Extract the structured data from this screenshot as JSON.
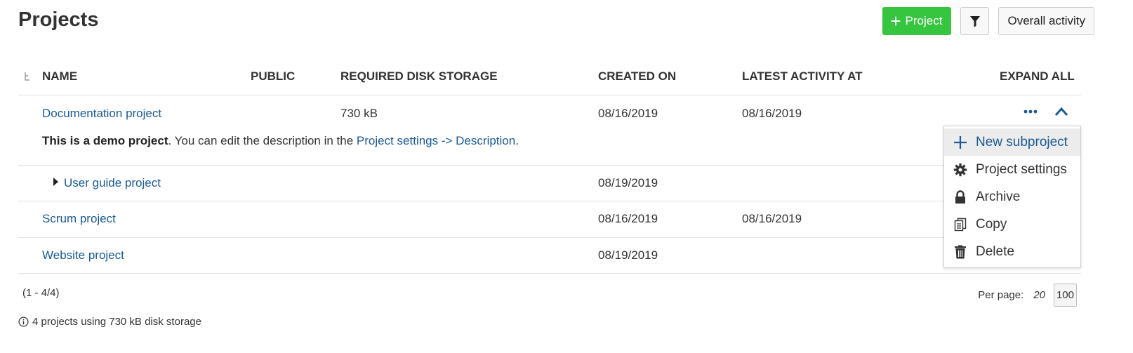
{
  "page": {
    "title": "Projects"
  },
  "toolbar": {
    "new_project_label": "Project",
    "filter_icon": "filter-icon",
    "overall_activity_label": "Overall activity"
  },
  "table": {
    "columns": {
      "name": "NAME",
      "public": "PUBLIC",
      "disk_storage": "REQUIRED DISK STORAGE",
      "created_on": "CREATED ON",
      "latest_activity": "LATEST ACTIVITY AT",
      "expand_all": "EXPAND ALL"
    },
    "rows": [
      {
        "name": "Documentation project",
        "disk_storage": "730 kB",
        "created_on": "08/16/2019",
        "latest_activity": "08/16/2019",
        "description_bold": "This is a demo project",
        "description_text": ". You can edit the description in the ",
        "description_link": "Project settings -> Description",
        "description_end": "."
      },
      {
        "name": "User guide project",
        "created_on": "08/19/2019"
      },
      {
        "name": "Scrum project",
        "created_on": "08/16/2019",
        "latest_activity": "08/16/2019"
      },
      {
        "name": "Website project",
        "created_on": "08/19/2019"
      }
    ]
  },
  "context_menu": {
    "items": [
      {
        "label": "New subproject",
        "icon": "plus-icon"
      },
      {
        "label": "Project settings",
        "icon": "gear-icon"
      },
      {
        "label": "Archive",
        "icon": "lock-icon"
      },
      {
        "label": "Copy",
        "icon": "copy-icon"
      },
      {
        "label": "Delete",
        "icon": "trash-icon"
      }
    ]
  },
  "footer": {
    "pagination": "(1 - 4/4)",
    "per_page_label": "Per page:",
    "per_page_options": [
      "20",
      "100"
    ],
    "storage_summary": "4 projects using 730 kB disk storage"
  },
  "colors": {
    "primary_button": "#35c53f",
    "link": "#1a5a96"
  }
}
